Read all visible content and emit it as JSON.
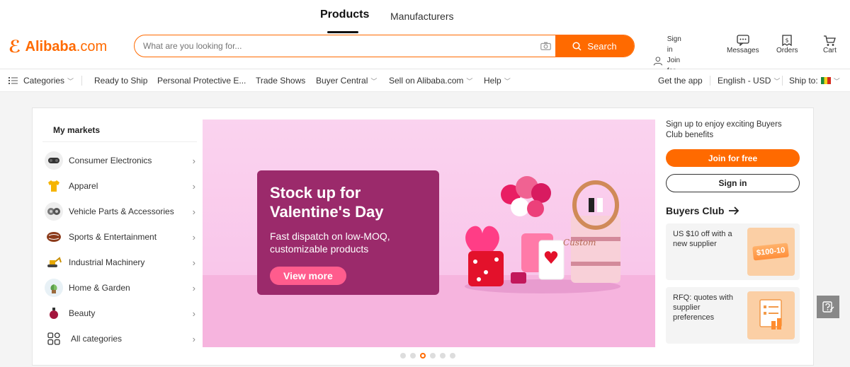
{
  "header": {
    "tabs": [
      {
        "label": "Products",
        "active": true
      },
      {
        "label": "Manufacturers",
        "active": false
      }
    ],
    "logo": {
      "brand": "Alibaba",
      "suffix": ".com"
    },
    "search": {
      "placeholder": "What are you looking for...",
      "button_label": "Search"
    },
    "account": {
      "line1": "Sign in",
      "line2": "Join for free"
    },
    "messages_label": "Messages",
    "orders_label": "Orders",
    "cart_label": "Cart",
    "accent_color": "#ff6a00"
  },
  "nav": {
    "categories_label": "Categories",
    "items": [
      "Ready to Ship",
      "Personal Protective E...",
      "Trade Shows",
      "Buyer Central",
      "Sell on Alibaba.com",
      "Help"
    ],
    "get_app": "Get the app",
    "language": "English - USD",
    "ship_to": "Ship to:"
  },
  "markets": {
    "title": "My markets",
    "items": [
      {
        "label": "Consumer Electronics",
        "icon": "headset-icon"
      },
      {
        "label": "Apparel",
        "icon": "shirt-icon"
      },
      {
        "label": "Vehicle Parts & Accessories",
        "icon": "engine-icon"
      },
      {
        "label": "Sports & Entertainment",
        "icon": "ball-icon"
      },
      {
        "label": "Industrial Machinery",
        "icon": "excavator-icon"
      },
      {
        "label": "Home & Garden",
        "icon": "plant-icon"
      },
      {
        "label": "Beauty",
        "icon": "perfume-icon"
      },
      {
        "label": "All categories",
        "icon": "grid-icon"
      }
    ]
  },
  "banner": {
    "headline": "Stock up for Valentine's Day",
    "subtext": "Fast dispatch on low-MOQ, customizable products",
    "cta": "View more",
    "cake_label": "Custom",
    "slides": 6,
    "active_slide": 3
  },
  "buyers": {
    "blurb": "Sign up to enjoy exciting Buyers Club benefits",
    "join_label": "Join for free",
    "signin_label": "Sign in",
    "club_title": "Buyers Club",
    "cards": [
      {
        "text": "US $10 off with a new supplier",
        "badge": "$100-10"
      },
      {
        "text": "RFQ: quotes with supplier preferences"
      }
    ]
  }
}
